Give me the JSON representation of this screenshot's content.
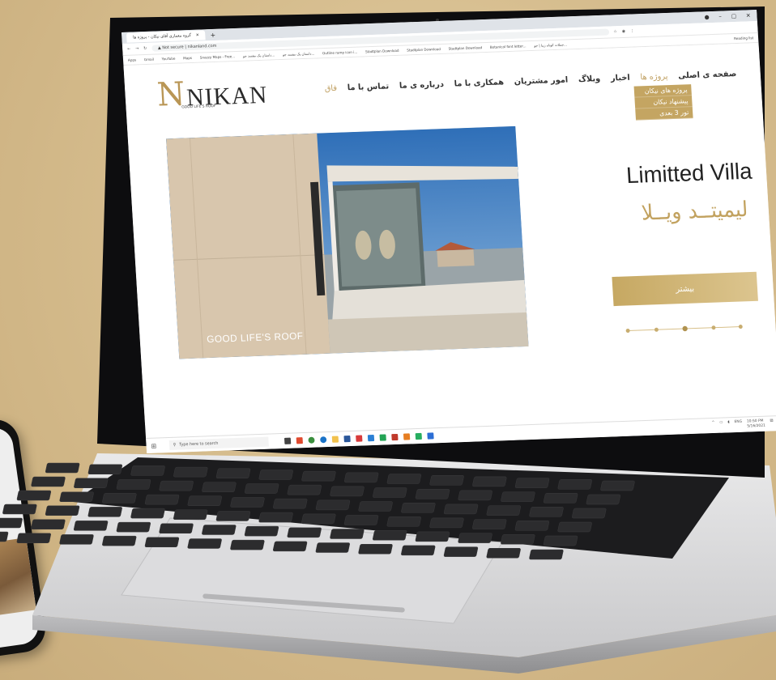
{
  "browser": {
    "tab_title": "گروه معماری آقای نیکان - پروژه ها",
    "url_prefix": "Not secure",
    "url": "nikanland.com",
    "bookmarks": [
      "Apps",
      "Gmail",
      "YouTube",
      "Maps",
      "Snazzy Maps - Free...",
      "داستان یک مفسد جو...",
      "داستان یک مفسد جو...",
      "Outline ramp icon i...",
      "Stadtplan Download",
      "Stadtplan Download",
      "Stadtplan Download",
      "Botanical font letter...",
      "جملات کوتاه زیبا | جو..."
    ],
    "reading_list": "Reading list"
  },
  "site": {
    "logo_text": "NIKAN",
    "logo_tagline": "GOOD LIFE'S ROOF",
    "nav": [
      {
        "label": "صفحه ی اصلی",
        "state": "bold"
      },
      {
        "label": "پروژه ها",
        "state": "active"
      },
      {
        "label": "اخبار",
        "state": "bold"
      },
      {
        "label": "وبلاگ",
        "state": "bold"
      },
      {
        "label": "امور مشتریان",
        "state": "bold"
      },
      {
        "label": "همکاری با ما",
        "state": "bold"
      },
      {
        "label": "درباره ی ما",
        "state": "bold"
      },
      {
        "label": "تماس با ما",
        "state": "bold"
      },
      {
        "label": "فاق",
        "state": "active"
      }
    ],
    "dropdown": [
      "پروژه های نیکان",
      "پیشنهاد نیکان",
      "تور 3 بعدی"
    ],
    "hero_caption": "GOOD LIFE'S ROOF",
    "title_en": "Limitted Villa",
    "title_fa": "لیمیتــد ویــلا",
    "more_button": "بیشتر"
  },
  "taskbar": {
    "search_placeholder": "Type here to search",
    "lang": "ENG",
    "time": "10:50 PM",
    "date": "5/16/2021"
  },
  "colors": {
    "accent_gold": "#c4a562",
    "background": "#d6bd8e"
  }
}
